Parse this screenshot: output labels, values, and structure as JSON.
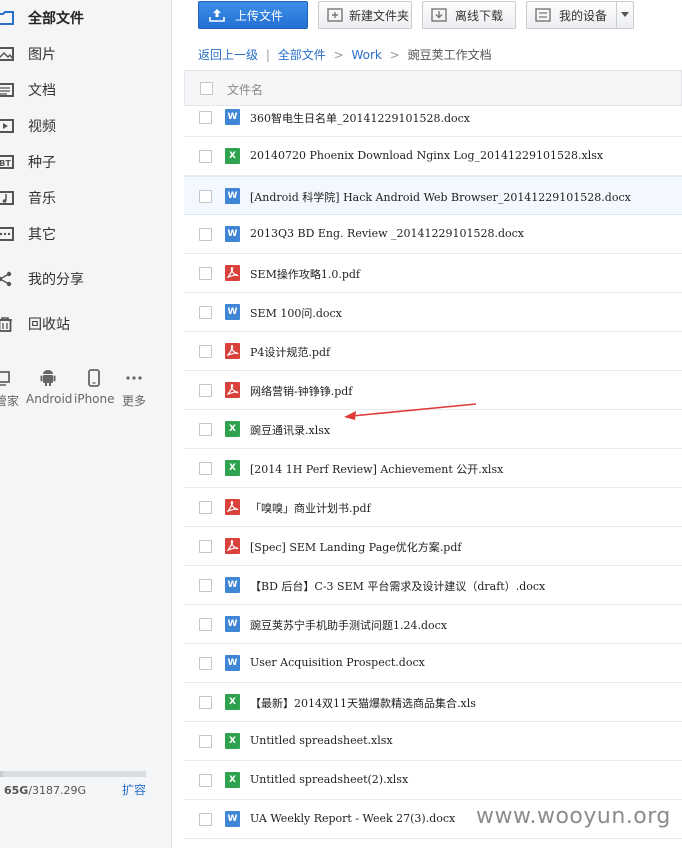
{
  "sidebar": {
    "nav": [
      {
        "label": "全部文件",
        "icon": "folder-icon"
      },
      {
        "label": "图片",
        "icon": "image-icon"
      },
      {
        "label": "文档",
        "icon": "document-icon"
      },
      {
        "label": "视频",
        "icon": "video-icon"
      },
      {
        "label": "种子",
        "icon": "bt-icon"
      },
      {
        "label": "音乐",
        "icon": "music-icon"
      },
      {
        "label": "其它",
        "icon": "more-dots-icon"
      },
      {
        "label": "我的分享",
        "icon": "share-icon"
      },
      {
        "label": "回收站",
        "icon": "trash-icon"
      }
    ],
    "devices": [
      {
        "label": "管家",
        "icon": "pc-icon"
      },
      {
        "label": "Android",
        "icon": "android-icon"
      },
      {
        "label": "iPhone",
        "icon": "iphone-icon"
      },
      {
        "label": "更多",
        "icon": "more-icon"
      }
    ],
    "quota": {
      "used": "65G",
      "total": "/3187.29G",
      "used_fraction": 0.02
    },
    "expand_label": "扩容"
  },
  "toolbar": {
    "upload": "上传文件",
    "new_folder": "新建文件夹",
    "offline_download": "离线下载",
    "my_devices": "我的设备"
  },
  "breadcrumb": {
    "back": "返回上一级",
    "bar": "|",
    "root": "全部文件",
    "sep": ">",
    "folder": "Work",
    "current": "豌豆荚工作文档"
  },
  "list": {
    "header_name": "文件名",
    "files": [
      {
        "name": "360智电生日名单_20141229101528.docx",
        "type": "W"
      },
      {
        "name": "20140720 Phoenix Download Nginx Log_20141229101528.xlsx",
        "type": "X"
      },
      {
        "name": "[Android 科学院] Hack Android Web Browser_20141229101528.docx",
        "type": "W"
      },
      {
        "name": "2013Q3 BD Eng. Review _20141229101528.docx",
        "type": "W"
      },
      {
        "name": "SEM操作攻略1.0.pdf",
        "type": "P"
      },
      {
        "name": "SEM 100问.docx",
        "type": "W"
      },
      {
        "name": "P4设计规范.pdf",
        "type": "P"
      },
      {
        "name": "网络营销-钟铮铮.pdf",
        "type": "P"
      },
      {
        "name": "豌豆通讯录.xlsx",
        "type": "X"
      },
      {
        "name": "[2014 1H Perf Review] Achievement 公开.xlsx",
        "type": "X"
      },
      {
        "name": "「嗅嗅」商业计划书.pdf",
        "type": "P"
      },
      {
        "name": "[Spec] SEM Landing Page优化方案.pdf",
        "type": "P"
      },
      {
        "name": "【BD 后台】C-3 SEM 平台需求及设计建议（draft）.docx",
        "type": "W"
      },
      {
        "name": "豌豆荚苏宁手机助手测试问题1.24.docx",
        "type": "W"
      },
      {
        "name": "User Acquisition Prospect.docx",
        "type": "W"
      },
      {
        "name": "【最新】2014双11天猫爆款精选商品集合.xls",
        "type": "X"
      },
      {
        "name": "Untitled spreadsheet.xlsx",
        "type": "X"
      },
      {
        "name": "Untitled spreadsheet(2).xlsx",
        "type": "X"
      },
      {
        "name": "UA Weekly Report - Week 27(3).docx",
        "type": "W"
      },
      {
        "name": "",
        "type": "W"
      }
    ]
  },
  "watermark": "www.wooyun.org",
  "colors": {
    "accent_blue": "#2270d2",
    "link_blue": "#2a6fc9",
    "word_blue": "#3f86d6",
    "excel_green": "#2ea24e",
    "pdf_red": "#d9413c",
    "arrow_red": "#e03b3b"
  }
}
